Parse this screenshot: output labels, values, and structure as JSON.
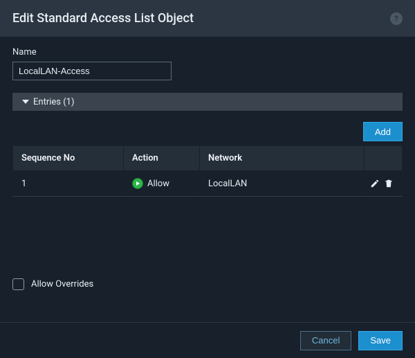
{
  "header": {
    "title": "Edit Standard Access List Object"
  },
  "fields": {
    "name_label": "Name",
    "name_value": "LocalLAN-Access"
  },
  "entries": {
    "header_label": "Entries (1)",
    "add_label": "Add",
    "columns": {
      "sequence": "Sequence No",
      "action": "Action",
      "network": "Network"
    },
    "rows": [
      {
        "sequence": "1",
        "action": "Allow",
        "network": "LocalLAN"
      }
    ]
  },
  "overrides": {
    "label": "Allow Overrides",
    "checked": false
  },
  "footer": {
    "cancel": "Cancel",
    "save": "Save"
  }
}
